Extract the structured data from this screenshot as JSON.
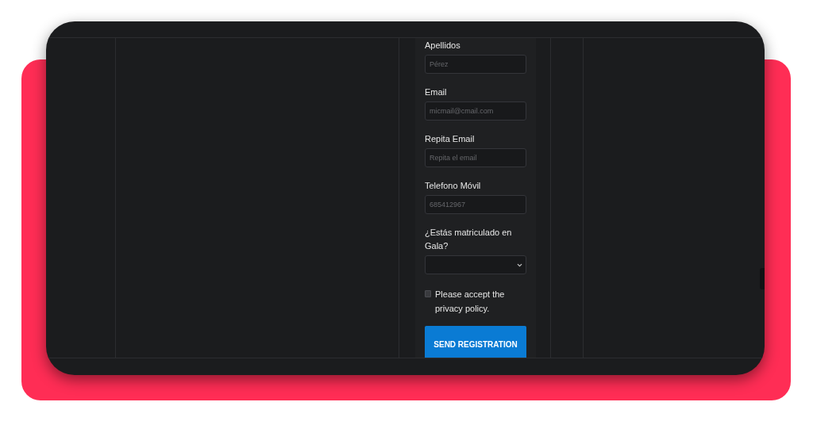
{
  "form": {
    "fields": [
      {
        "kind": "text",
        "label": "Apellidos",
        "placeholder": "Pérez"
      },
      {
        "kind": "text",
        "label": "Email",
        "placeholder": "micmail@cmail.com"
      },
      {
        "kind": "text",
        "label": "Repita Email",
        "placeholder": "Repita el email"
      },
      {
        "kind": "text",
        "label": "Telefono Móvil",
        "placeholder": "685412967"
      },
      {
        "kind": "select",
        "label": "¿Estás matriculado en Gala?"
      }
    ],
    "privacy": {
      "label": "Please accept the privacy policy.",
      "checked": false
    },
    "submit": "SEND REGISTRATION"
  }
}
